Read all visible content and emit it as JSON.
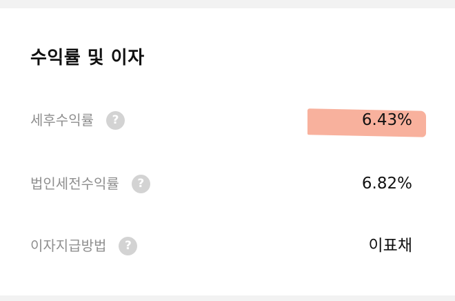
{
  "section": {
    "title": "수익률 및 이자"
  },
  "rows": [
    {
      "label": "세후수익률",
      "value": "6.43%",
      "highlighted": true
    },
    {
      "label": "법인세전수익률",
      "value": "6.82%",
      "highlighted": false
    },
    {
      "label": "이자지급방법",
      "value": "이표채",
      "highlighted": false
    }
  ],
  "icons": {
    "help": "question-mark-circle-icon",
    "help_glyph": "?"
  },
  "colors": {
    "highlight": "#f7a892",
    "label": "#8e8e8e",
    "value": "#111111",
    "help_icon_bg": "#d3d3d3"
  }
}
